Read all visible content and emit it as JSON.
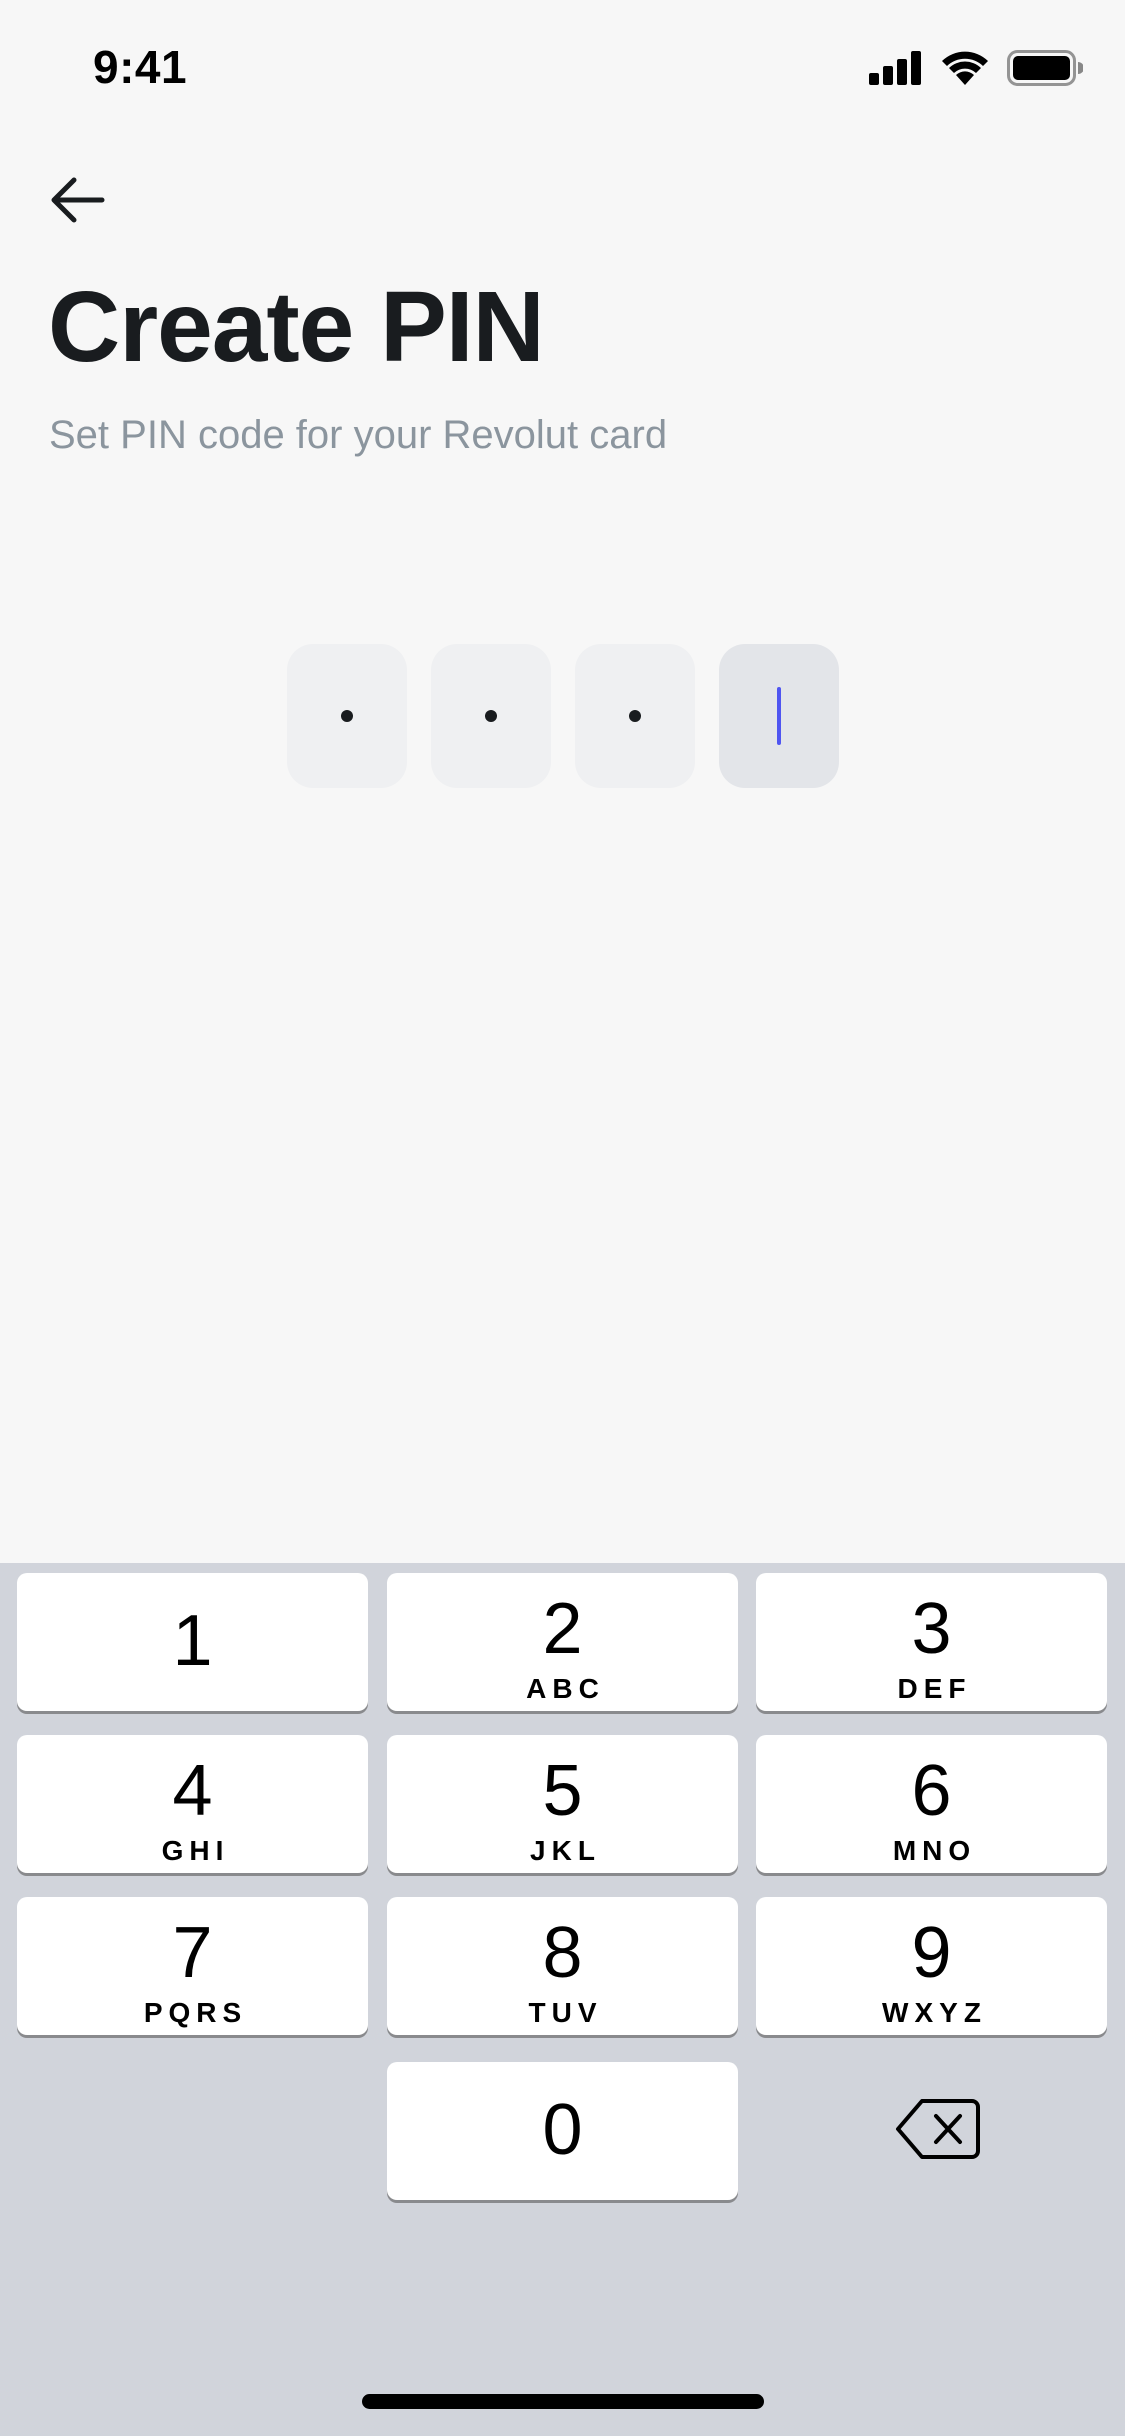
{
  "status_bar": {
    "time": "9:41",
    "icons": [
      "cellular-signal-icon",
      "wifi-icon",
      "battery-icon"
    ]
  },
  "header": {
    "back_icon": "arrow-left-icon",
    "title": "Create PIN",
    "subtitle": "Set PIN code for your Revolut card"
  },
  "pin": {
    "length": 4,
    "filled": 3,
    "masked_char": "•",
    "cursor_color": "#4f55f1"
  },
  "keypad": {
    "keys": [
      {
        "digit": "1",
        "letters": ""
      },
      {
        "digit": "2",
        "letters": "ABC"
      },
      {
        "digit": "3",
        "letters": "DEF"
      },
      {
        "digit": "4",
        "letters": "GHI"
      },
      {
        "digit": "5",
        "letters": "JKL"
      },
      {
        "digit": "6",
        "letters": "MNO"
      },
      {
        "digit": "7",
        "letters": "PQRS"
      },
      {
        "digit": "8",
        "letters": "TUV"
      },
      {
        "digit": "9",
        "letters": "WXYZ"
      },
      {
        "digit": "0",
        "letters": ""
      }
    ],
    "delete_icon": "backspace-icon"
  },
  "colors": {
    "background": "#f7f7f7",
    "keyboard_background": "#d1d4db",
    "title": "#191c1f",
    "subtitle": "#8b959e"
  }
}
